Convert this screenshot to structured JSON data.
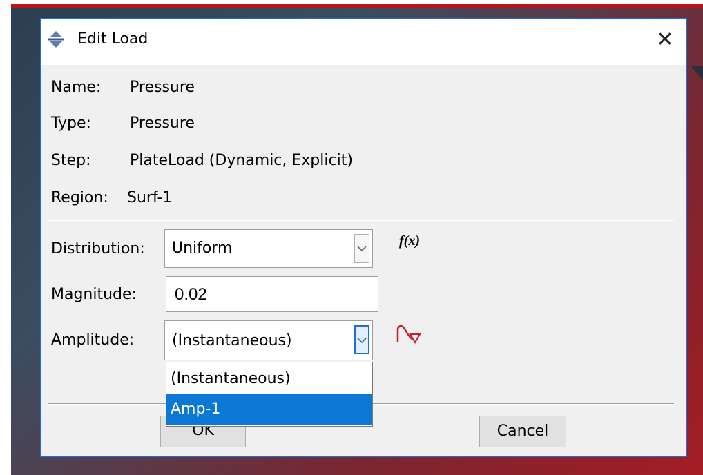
{
  "dialog": {
    "title": "Edit Load",
    "close_label": "✕"
  },
  "info": {
    "name_label": "Name:",
    "name_value": "Pressure",
    "type_label": "Type:",
    "type_value": "Pressure",
    "step_label": "Step:",
    "step_value": "PlateLoad (Dynamic, Explicit)",
    "region_label": "Region:",
    "region_value": "Surf-1"
  },
  "form": {
    "distribution_label": "Distribution:",
    "distribution_value": "Uniform",
    "fx_label": "f(x)",
    "magnitude_label": "Magnitude:",
    "magnitude_value": "0.02",
    "amplitude_label": "Amplitude:",
    "amplitude_value": "(Instantaneous)"
  },
  "amplitude_dropdown": {
    "options": [
      "(Instantaneous)",
      "Amp-1"
    ],
    "highlighted": "Amp-1"
  },
  "buttons": {
    "ok_label": "OK",
    "cancel_label": "Cancel"
  },
  "colors": {
    "frame": "#b5161c",
    "accent": "#1e6fd0",
    "selection": "#0a78d4",
    "amplitude_icon": "#c0202a"
  }
}
